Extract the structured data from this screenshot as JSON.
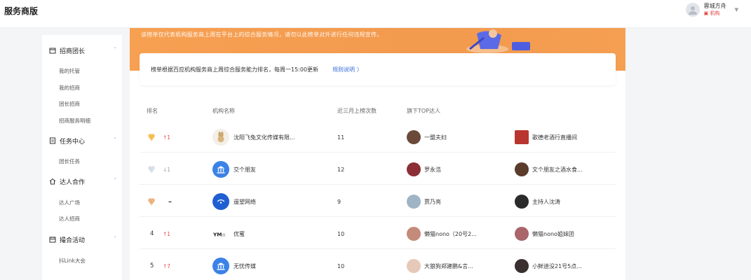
{
  "app": {
    "title": "服务商版"
  },
  "user": {
    "name": "蓉城方舟",
    "role": "机构"
  },
  "sidebar": {
    "groups": [
      {
        "label": "招商团长",
        "items": [
          "我的托管",
          "我的招商",
          "团长招商",
          "招商服务明细"
        ]
      },
      {
        "label": "任务中心",
        "items": [
          "团长任务"
        ]
      },
      {
        "label": "达人合作",
        "items": [
          "达人广场",
          "达人招商"
        ]
      },
      {
        "label": "撮合活动",
        "items": [
          "抖Link大会"
        ]
      }
    ]
  },
  "banner": {
    "text": "该榜单仅代表机构服务商上周在平台上的综合服务情况，请勿以此榜单对外进行任何违规宣传。"
  },
  "notice": {
    "text": "榜单根据百应机构服务商上周综合服务能力排名，每周一15:00更新",
    "link": "规则说明 〉"
  },
  "table": {
    "headers": {
      "rank": "排名",
      "org": "机构名称",
      "count": "近三月上榜次数",
      "top": "旗下TOP达人"
    },
    "rows": [
      {
        "rank": "",
        "medal": "gold",
        "delta": "↑1",
        "trend": "up",
        "org": "沈阳飞兔文化传媒有限...",
        "logo": "rabbit",
        "count": "11",
        "t1": "一盟夫妇",
        "t2": "歌德老酒行直播间"
      },
      {
        "rank": "",
        "medal": "silver",
        "delta": "↓1",
        "trend": "down",
        "org": "交个朋友",
        "logo": "bank",
        "count": "12",
        "t1": "罗永浩",
        "t2": "文个朋友之酒水食..."
      },
      {
        "rank": "",
        "medal": "bronze",
        "delta": "–",
        "trend": "flat",
        "org": "遥望网络",
        "logo": "yaowang",
        "count": "9",
        "t1": "贾乃亮",
        "t2": "主持人沈涛"
      },
      {
        "rank": "4",
        "medal": "",
        "delta": "↑1",
        "trend": "up",
        "org": "优蜜",
        "logo": "youmi",
        "count": "10",
        "t1": "懒猫nono（20号2...",
        "t2": "懒猫nono姐妹团"
      },
      {
        "rank": "5",
        "medal": "",
        "delta": "↑7",
        "trend": "up",
        "org": "无忧传媒",
        "logo": "bank",
        "count": "10",
        "t1": "大狼狗郑建鹏&言...",
        "t2": "小鲜迪没21号5点..."
      }
    ]
  },
  "colors": {
    "accent": "#f29a4e",
    "link": "#3a6fd8",
    "up": "#e94c4c",
    "logo_blue": "#3b82e6"
  }
}
